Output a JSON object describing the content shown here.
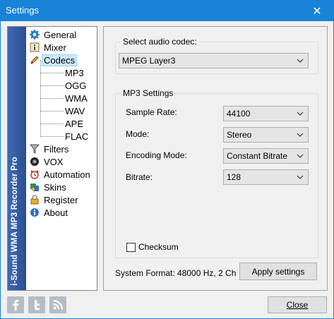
{
  "window": {
    "title": "Settings",
    "close_glyph": "✕"
  },
  "brand": {
    "text": "i-Sound WMA MP3 Recorder Pro"
  },
  "nav": {
    "items": [
      {
        "label": "General",
        "icon": "gear-icon"
      },
      {
        "label": "Mixer",
        "icon": "info-icon"
      },
      {
        "label": "Codecs",
        "icon": "pencil-icon",
        "selected": true
      },
      {
        "label": "Filters",
        "icon": "funnel-icon"
      },
      {
        "label": "VOX",
        "icon": "speaker-icon"
      },
      {
        "label": "Automation",
        "icon": "alarm-clock-icon"
      },
      {
        "label": "Skins",
        "icon": "skins-icon"
      },
      {
        "label": "Register",
        "icon": "lock-icon"
      },
      {
        "label": "About",
        "icon": "info-circle-icon"
      }
    ],
    "codecs_children": [
      "MP3",
      "OGG",
      "WMA",
      "WAV",
      "APE",
      "FLAC"
    ]
  },
  "codec": {
    "group_title": "Select audio codec:",
    "selected": "MPEG Layer3"
  },
  "mp3": {
    "group_title": "MP3 Settings",
    "sample_rate_label": "Sample Rate:",
    "sample_rate_value": "44100",
    "mode_label": "Mode:",
    "mode_value": "Stereo",
    "encoding_label": "Encoding Mode:",
    "encoding_value": "Constant Bitrate",
    "bitrate_label": "Bitrate:",
    "bitrate_value": "128",
    "checksum_label": "Checksum",
    "checksum_checked": false
  },
  "footer": {
    "system_format": "System Format: 48000 Hz, 2 Ch",
    "apply_label": "Apply settings",
    "close_label": "Close"
  },
  "social": {
    "facebook": "f",
    "twitter": "t",
    "rss": "rss"
  },
  "colors": {
    "titlebar": "#1883d7",
    "brand_strip": "#3e69b3",
    "selection": "#cce8ff"
  }
}
